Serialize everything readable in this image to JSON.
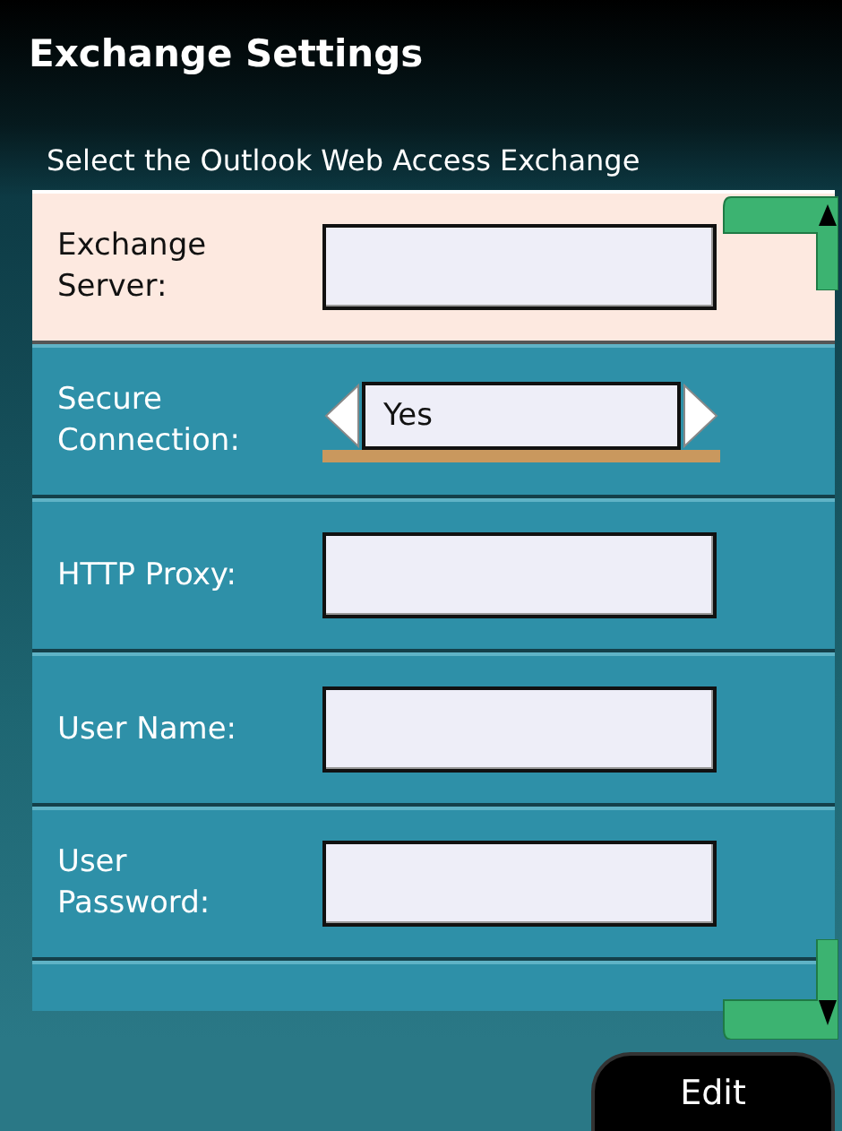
{
  "window": {
    "title": "Exchange Settings"
  },
  "instruction": "Select the Outlook Web Access Exchange",
  "settings": [
    {
      "kind": "text",
      "label": "Exchange\nServer:",
      "selected": true
    },
    {
      "kind": "spinner",
      "label": "Secure\nConnection:",
      "value": "Yes",
      "selected": false
    },
    {
      "kind": "text",
      "label": "HTTP Proxy:",
      "selected": false
    },
    {
      "kind": "text",
      "label": "User Name:",
      "selected": false
    },
    {
      "kind": "text",
      "label": "User\nPassword:",
      "selected": false
    }
  ],
  "softkey": "Edit"
}
